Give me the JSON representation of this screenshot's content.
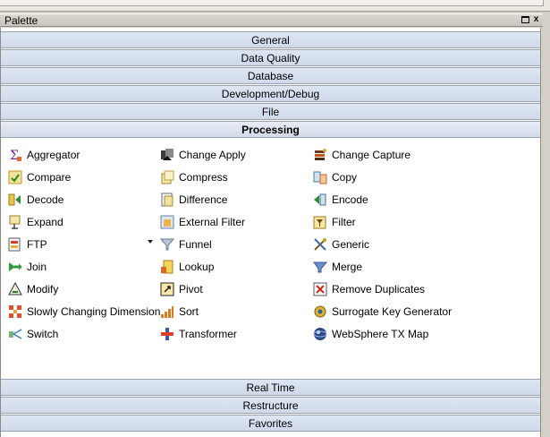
{
  "panel": {
    "title": "Palette",
    "restore_button": "restore",
    "close_button": "x"
  },
  "drawers_top": [
    {
      "label": "General"
    },
    {
      "label": "Data Quality"
    },
    {
      "label": "Database"
    },
    {
      "label": "Development/Debug"
    },
    {
      "label": "File"
    },
    {
      "label": "Processing",
      "active": true
    }
  ],
  "processing_items": [
    {
      "label": "Aggregator",
      "icon": "aggregator-icon"
    },
    {
      "label": "Change Apply",
      "icon": "change-apply-icon"
    },
    {
      "label": "Change Capture",
      "icon": "change-capture-icon"
    },
    {
      "label": "Compare",
      "icon": "compare-icon"
    },
    {
      "label": "Compress",
      "icon": "compress-icon"
    },
    {
      "label": "Copy",
      "icon": "copy-icon"
    },
    {
      "label": "Decode",
      "icon": "decode-icon"
    },
    {
      "label": "Difference",
      "icon": "difference-icon"
    },
    {
      "label": "Encode",
      "icon": "encode-icon"
    },
    {
      "label": "Expand",
      "icon": "expand-icon"
    },
    {
      "label": "External Filter",
      "icon": "external-filter-icon"
    },
    {
      "label": "Filter",
      "icon": "filter-icon"
    },
    {
      "label": "FTP",
      "icon": "ftp-icon"
    },
    {
      "label": "Funnel",
      "icon": "funnel-icon"
    },
    {
      "label": "Generic",
      "icon": "generic-icon"
    },
    {
      "label": "Join",
      "icon": "join-icon"
    },
    {
      "label": "Lookup",
      "icon": "lookup-icon"
    },
    {
      "label": "Merge",
      "icon": "merge-icon"
    },
    {
      "label": "Modify",
      "icon": "modify-icon"
    },
    {
      "label": "Pivot",
      "icon": "pivot-icon"
    },
    {
      "label": "Remove Duplicates",
      "icon": "remove-duplicates-icon"
    },
    {
      "label": "Slowly Changing Dimension",
      "icon": "slowly-changing-dimension-icon"
    },
    {
      "label": "Sort",
      "icon": "sort-icon"
    },
    {
      "label": "Surrogate Key Generator",
      "icon": "surrogate-key-generator-icon"
    },
    {
      "label": "Switch",
      "icon": "switch-icon"
    },
    {
      "label": "Transformer",
      "icon": "transformer-icon"
    },
    {
      "label": "WebSphere TX Map",
      "icon": "websphere-tx-map-icon"
    }
  ],
  "drawers_bottom": [
    {
      "label": "Real Time"
    },
    {
      "label": "Restructure"
    },
    {
      "label": "Favorites"
    }
  ],
  "colors": {
    "drawer_bg": "#d6dfee",
    "drawer_border": "#9aa4b5",
    "list_bg": "#ffffff"
  }
}
